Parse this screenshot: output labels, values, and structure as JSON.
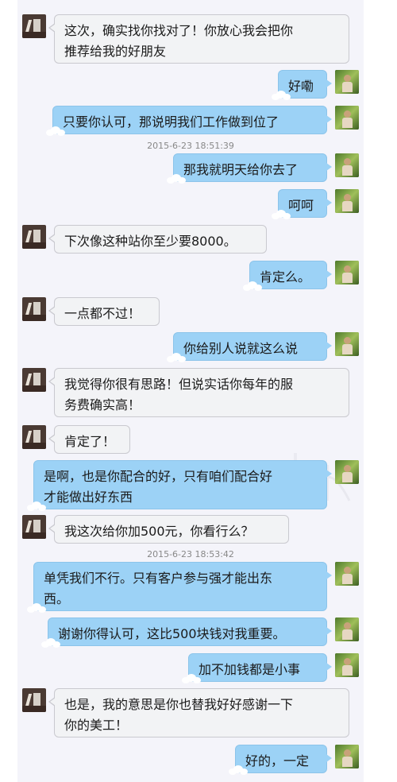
{
  "messages": [
    {
      "id": "m1",
      "side": "left",
      "text": "这次，确实找你找对了！你放心我会把你\n推荐给我的好朋友"
    },
    {
      "id": "m2",
      "side": "right",
      "text": "好嘞"
    },
    {
      "id": "m3",
      "side": "right",
      "text": "只要你认可，那说明我们工作做到位了"
    },
    {
      "id": "m4",
      "side": "right",
      "text": "那我就明天给你去了"
    },
    {
      "id": "m5",
      "side": "right",
      "text": "呵呵"
    },
    {
      "id": "m6",
      "side": "left",
      "text": "下次像这种站你至少要8000。"
    },
    {
      "id": "m7",
      "side": "right",
      "text": "肯定么。"
    },
    {
      "id": "m8",
      "side": "left",
      "text": "一点都不过！"
    },
    {
      "id": "m9",
      "side": "right",
      "text": "你给别人说就这么说"
    },
    {
      "id": "m10",
      "side": "left",
      "text": "我觉得你很有思路！但说实话你每年的服\n务费确实高！"
    },
    {
      "id": "m11",
      "side": "left",
      "text": "肯定了！"
    },
    {
      "id": "m12",
      "side": "right",
      "text": "是啊，也是你配合的好，只有咱们配合好\n才能做出好东西"
    },
    {
      "id": "m13",
      "side": "left",
      "text": "我这次给你加500元，你看行么？"
    },
    {
      "id": "m14",
      "side": "right",
      "text": "单凭我们不行。只有客户参与强才能出东\n西。"
    },
    {
      "id": "m15",
      "side": "right",
      "text": "谢谢你得认可，这比500块钱对我重要。"
    },
    {
      "id": "m16",
      "side": "right",
      "text": "加不加钱都是小事"
    },
    {
      "id": "m17",
      "side": "left",
      "text": "也是，我的意思是你也替我好好感谢一下\n你的美工！"
    },
    {
      "id": "m18",
      "side": "right",
      "text": "好的，一定"
    }
  ],
  "timestamps": [
    {
      "id": "t1",
      "text": "2015-6-23 18:51:39"
    },
    {
      "id": "t2",
      "text": "2015-6-23 18:53:42"
    }
  ],
  "colors": {
    "panel_bg": "#f4f4fa",
    "bubble_self": "#9cd2f6",
    "bubble_other": "#f2f3f5",
    "timestamp_text": "#888888"
  },
  "icons": {
    "other_avatar": "contact-avatar-icon",
    "self_avatar": "user-avatar-icon"
  }
}
